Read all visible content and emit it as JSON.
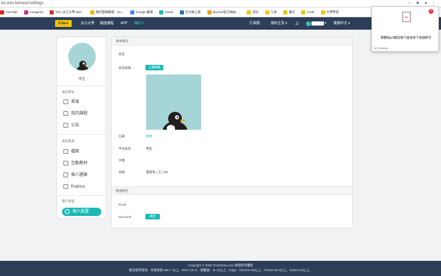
{
  "browser": {
    "url": "ku.edu.tw/user/settings",
    "bookmarks": [
      {
        "label": "YouTube",
        "color": "#e62117"
      },
      {
        "label": "Instagram",
        "color": "#c13584"
      },
      {
        "label": "TKU 淡江大學 Wel...",
        "color": "#c0392b"
      },
      {
        "label": "我的雲端硬碟 - Go...",
        "color": "#f4b400"
      },
      {
        "label": "Google 翻譯",
        "color": "#4285f4"
      },
      {
        "label": "iClass",
        "color": "#1cb9b5"
      },
      {
        "label": "元大線上速",
        "color": "#2e6db4"
      },
      {
        "label": "MyCard官方網站 -...",
        "color": "#f39c12"
      },
      {
        "label": "日份",
        "color": "#f1c40f"
      },
      {
        "label": "工具",
        "color": "#f1c40f"
      },
      {
        "label": "書信",
        "color": "#f1c40f"
      },
      {
        "label": "Code",
        "color": "#f1c40f"
      },
      {
        "label": "大學學習",
        "color": "#f1c40f"
      }
    ]
  },
  "nav": {
    "logo": "iClass",
    "items": [
      "淡江大學",
      "開放課程",
      "APP",
      "輔助"
    ],
    "right": [
      "行事曆",
      "我的主頁",
      "繁體中文"
    ]
  },
  "notification": {
    "message": "偶爾點pdf檔案要介面再修下後鏈即可",
    "by": "by Yicheng"
  },
  "sidebar": {
    "role": "學生",
    "sections": [
      {
        "title": "我的學習",
        "items": [
          "首頁",
          "我的課程",
          "公告"
        ]
      },
      {
        "title": "我的資源",
        "items": [
          "檔案",
          "互動教材",
          "個人題庫",
          "Rubrics"
        ]
      },
      {
        "title": "帳戶管理",
        "items": [
          "個人設置"
        ]
      }
    ]
  },
  "settings": {
    "basic_title": "基本資訊",
    "name_label": "姓名",
    "avatar_label": "目前頭像",
    "upload_button": "上傳頭像",
    "email_label": "信箱",
    "email_link": "修改",
    "role_label": "平台角色",
    "role_value": "學生",
    "phone_label": "手機",
    "dept_label": "系級",
    "dept_value": "資管系 ( 三 ) 3B",
    "binding_title": "帳號綁定",
    "email_bind_label": "Email",
    "microsoft_label": "Microsoft",
    "unbind_button": "綁定"
  },
  "footer": {
    "copyright": "Copyright © 2020 TronClass.com 保留所有權利",
    "compat": "最佳使用環境：作業系統 Win 7 以上、MAC OS X、瀏覽器：IE 11以上、Edge、Chrome 60以上、Firefox 58.0以上、Safari 9.0以上。"
  }
}
